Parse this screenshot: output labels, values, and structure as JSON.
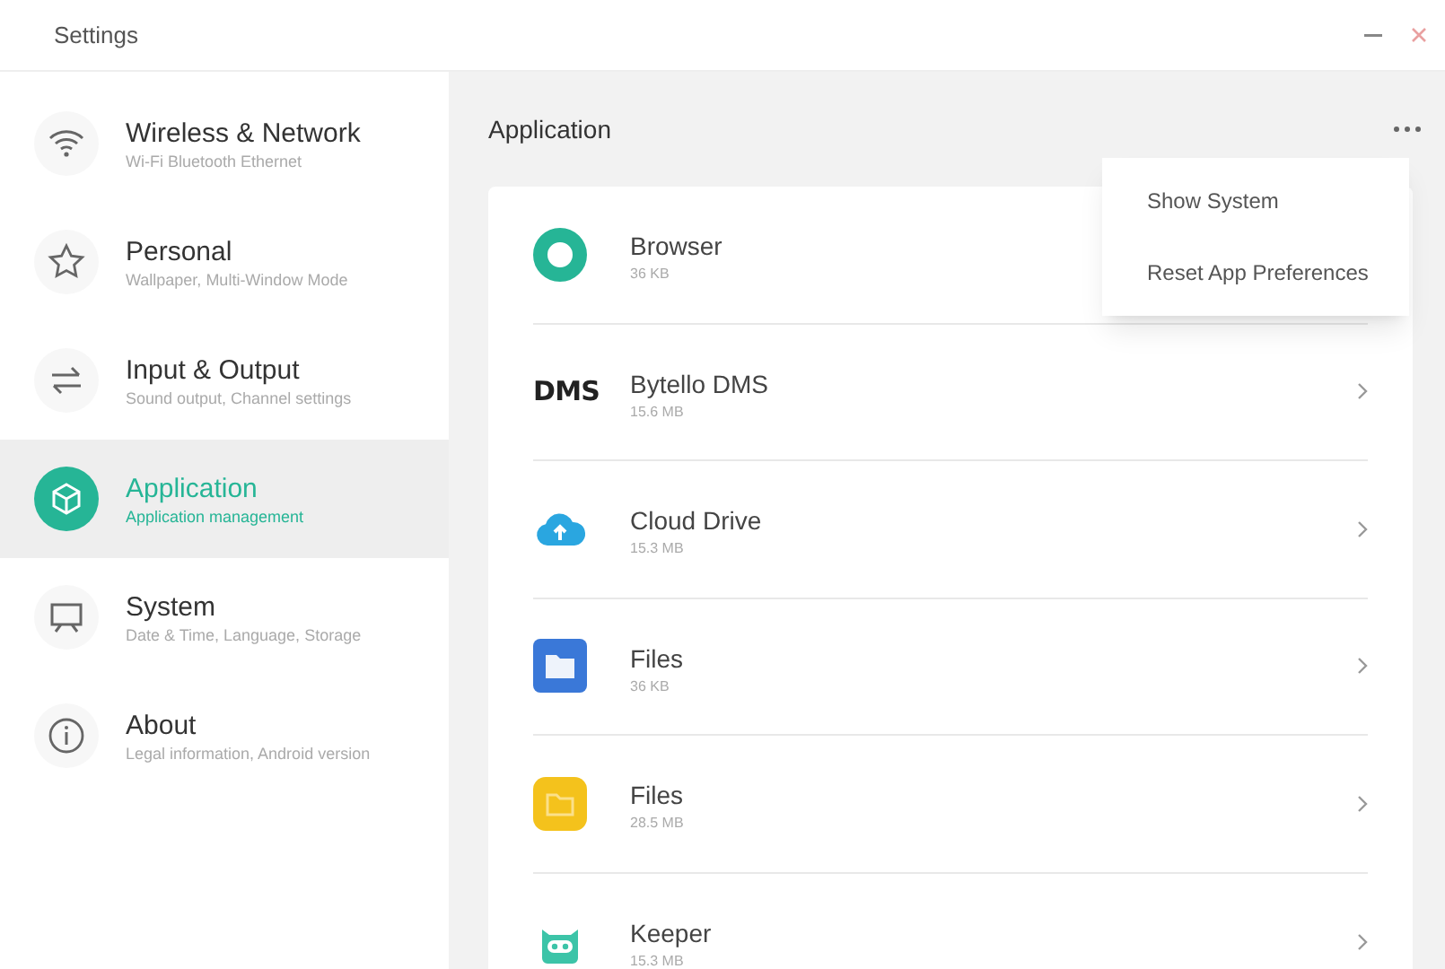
{
  "window": {
    "title": "Settings"
  },
  "sidebar": {
    "items": [
      {
        "kind": "wifi",
        "label": "Wireless & Network",
        "description": "Wi-Fi Bluetooth Ethernet",
        "selected": false
      },
      {
        "kind": "star",
        "label": "Personal",
        "description": "Wallpaper, Multi-Window Mode",
        "selected": false
      },
      {
        "kind": "arrows",
        "label": "Input & Output",
        "description": "Sound output, Channel settings",
        "selected": false
      },
      {
        "kind": "cube",
        "label": "Application",
        "description": "Application management",
        "selected": true
      },
      {
        "kind": "monitor",
        "label": "System",
        "description": "Date & Time, Language, Storage",
        "selected": false
      },
      {
        "kind": "info",
        "label": "About",
        "description": "Legal information, Android version",
        "selected": false
      }
    ]
  },
  "content": {
    "title": "Application",
    "apps": [
      {
        "kind": "ring",
        "name": "Browser",
        "size": "36 KB"
      },
      {
        "kind": "text",
        "logo_text": "DMS",
        "name": "Bytello DMS",
        "size": "15.6 MB"
      },
      {
        "kind": "cloud",
        "name": "Cloud Drive",
        "size": "15.3 MB"
      },
      {
        "kind": "folder",
        "name": "Files",
        "size": "36 KB"
      },
      {
        "kind": "yellow_folder",
        "name": "Files",
        "size": "28.5 MB"
      },
      {
        "kind": "robot",
        "name": "Keeper",
        "size": "15.3 MB"
      }
    ]
  },
  "menu": {
    "items": [
      "Show System",
      "Reset App Preferences"
    ]
  }
}
